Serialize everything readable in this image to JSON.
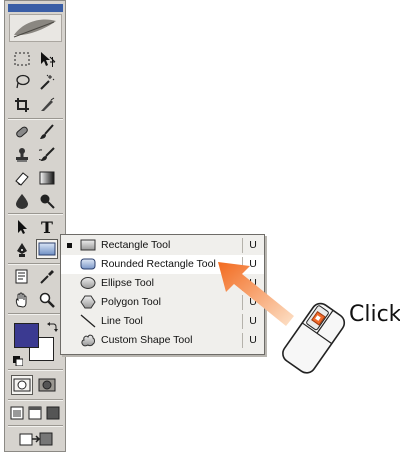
{
  "toolbox": {
    "tools": [
      {
        "name": "marquee-icon"
      },
      {
        "name": "move-icon"
      },
      {
        "name": "lasso-icon"
      },
      {
        "name": "magic-wand-icon"
      },
      {
        "name": "crop-icon"
      },
      {
        "name": "slice-icon"
      },
      {
        "name": "healing-brush-icon"
      },
      {
        "name": "brush-icon"
      },
      {
        "name": "clone-stamp-icon"
      },
      {
        "name": "history-brush-icon"
      },
      {
        "name": "eraser-icon"
      },
      {
        "name": "gradient-icon"
      },
      {
        "name": "blur-icon"
      },
      {
        "name": "dodge-icon"
      },
      {
        "name": "path-selection-icon"
      },
      {
        "name": "type-icon"
      },
      {
        "name": "pen-icon"
      },
      {
        "name": "rectangle-shape-icon"
      },
      {
        "name": "notes-icon"
      },
      {
        "name": "eyedropper-icon"
      },
      {
        "name": "hand-icon"
      },
      {
        "name": "zoom-icon"
      }
    ],
    "foreground_color": "#3b3a91",
    "background_color": "#ffffff"
  },
  "flyout": {
    "items": [
      {
        "label": "Rectangle Tool",
        "shortcut": "U",
        "icon": "rectangle-icon",
        "selected": true
      },
      {
        "label": "Rounded Rectangle Tool",
        "shortcut": "U",
        "icon": "rounded-rectangle-icon",
        "highlighted": true
      },
      {
        "label": "Ellipse Tool",
        "shortcut": "U",
        "icon": "ellipse-icon"
      },
      {
        "label": "Polygon Tool",
        "shortcut": "U",
        "icon": "polygon-icon"
      },
      {
        "label": "Line Tool",
        "shortcut": "U",
        "icon": "line-icon"
      },
      {
        "label": "Custom Shape Tool",
        "shortcut": "U",
        "icon": "custom-shape-icon"
      }
    ]
  },
  "callout": {
    "label": "Click",
    "arrow_color": "#f08a3c"
  }
}
